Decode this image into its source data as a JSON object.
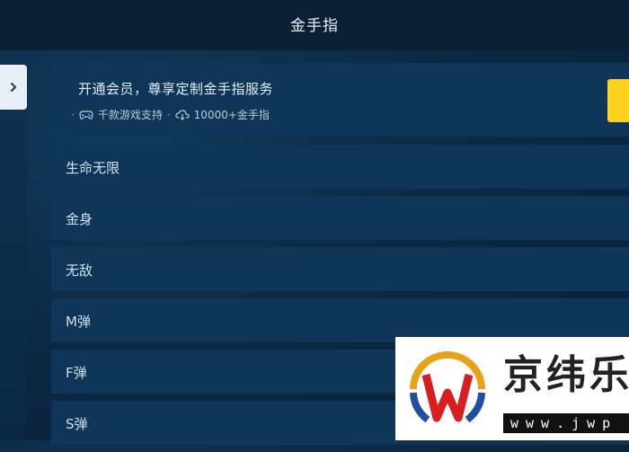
{
  "header": {
    "title": "金手指"
  },
  "sidebar": {
    "expand_icon": "chevron-right-icon"
  },
  "promo": {
    "title": "开通会员，尊享定制金手指服务",
    "bullet": "·",
    "games_icon": "gamepad-icon",
    "games_text": "千款游戏支持",
    "cloud_icon": "cloud-download-icon",
    "cheats_text": "10000+金手指",
    "button_color": "#ffd21f"
  },
  "cheats": [
    {
      "label": "生命无限"
    },
    {
      "label": "金身"
    },
    {
      "label": "无敌"
    },
    {
      "label": "M弹"
    },
    {
      "label": "F弹"
    },
    {
      "label": "S弹"
    }
  ],
  "watermark": {
    "brand": "京纬乐",
    "url": "www.jwp"
  },
  "colors": {
    "background": "#0b2a45",
    "row": "#0f3558",
    "accent": "#ffd21f"
  }
}
